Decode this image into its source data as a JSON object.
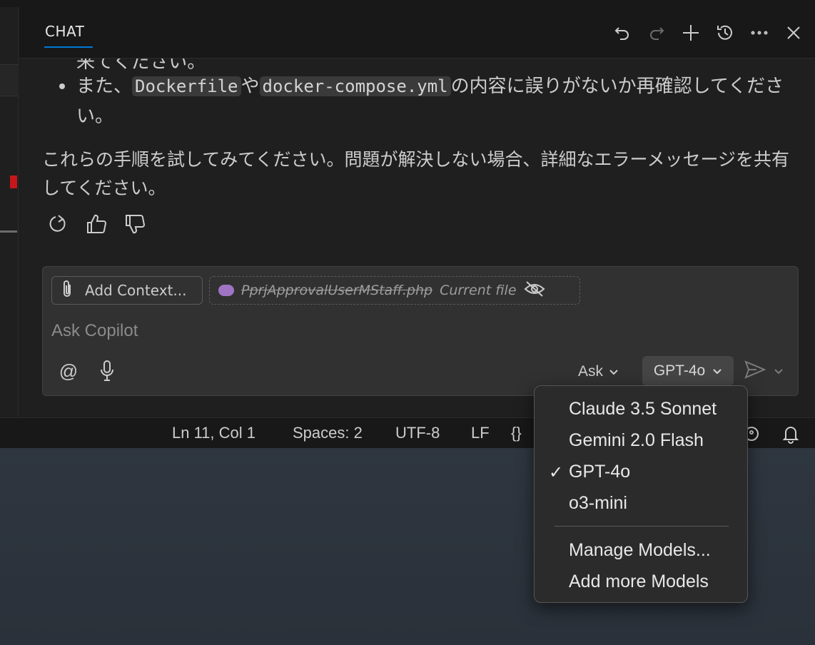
{
  "chat": {
    "tab_label": "CHAT",
    "header_icons": [
      "undo-icon",
      "redo-icon",
      "plus-icon",
      "history-icon",
      "more-icon",
      "close-icon"
    ]
  },
  "messages": {
    "prev_cut": "来てください。",
    "bullet_prefix": "また、",
    "bullet_code1": "Dockerfile",
    "bullet_mid": "や",
    "bullet_code2": "docker-compose.yml",
    "bullet_suffix": "の内容に誤りがないか再確認してください。",
    "paragraph": "これらの手順を試してみてください。問題が解決しない場合、詳細なエラーメッセージを共有してください。"
  },
  "input": {
    "add_context_label": "Add Context...",
    "file_name": "PprjApprovalUserMStaff.php",
    "file_note": "Current file",
    "placeholder": "Ask Copilot",
    "mode_label": "Ask",
    "model_label": "GPT-4o"
  },
  "statusbar": {
    "position": "Ln 11, Col 1",
    "spaces": "Spaces: 2",
    "encoding": "UTF-8",
    "eol": "LF",
    "braces": "{}"
  },
  "dropdown": {
    "items": [
      "Claude 3.5 Sonnet",
      "Gemini 2.0 Flash",
      "GPT-4o",
      "o3-mini"
    ],
    "selected": "GPT-4o",
    "check": "✓",
    "manage": "Manage Models...",
    "add_more": "Add more Models"
  }
}
